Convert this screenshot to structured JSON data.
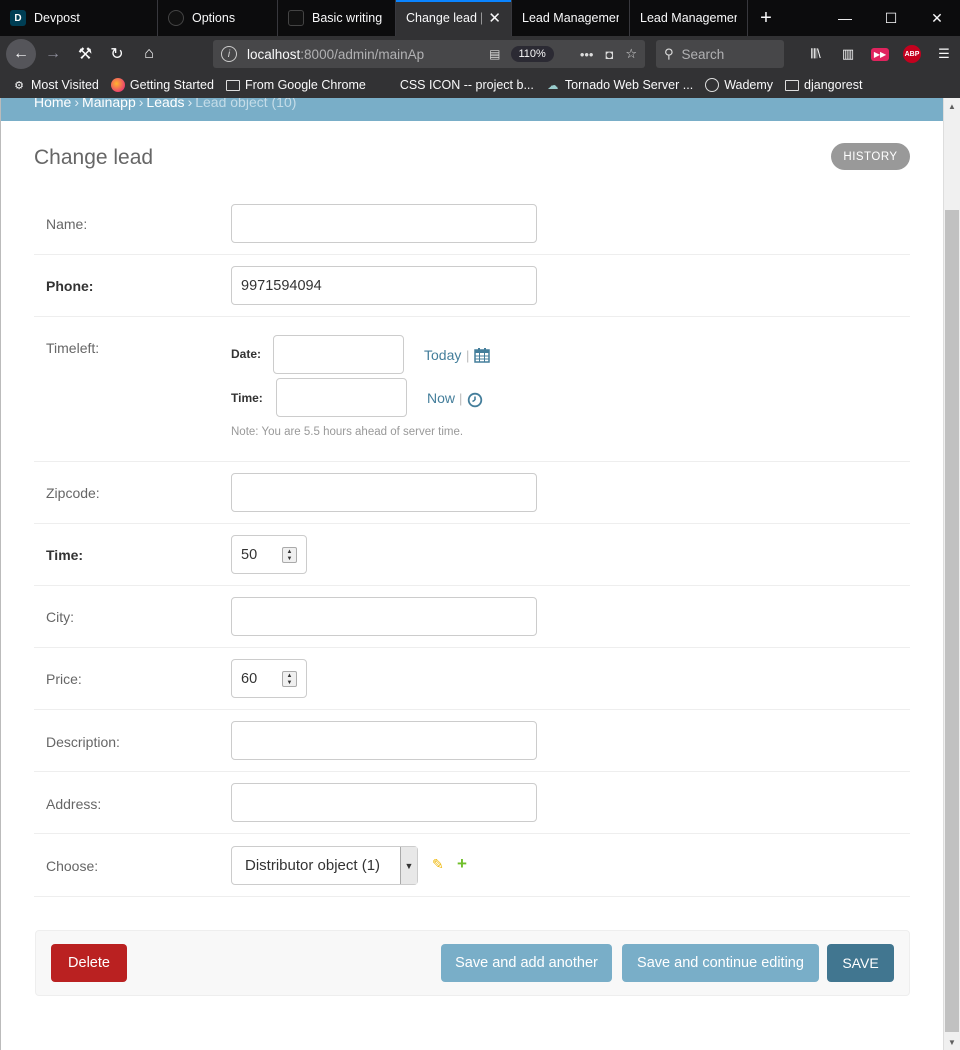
{
  "browser": {
    "tabs": [
      {
        "title": "Devpost",
        "favicon": "D"
      },
      {
        "title": "Options",
        "favicon": ""
      },
      {
        "title": "Basic writing a",
        "favicon": ""
      },
      {
        "title": "Change lead | D",
        "favicon": "",
        "active": true
      },
      {
        "title": "Lead Managemen",
        "favicon": ""
      },
      {
        "title": "Lead Managemen",
        "favicon": ""
      }
    ],
    "url_host": "localhost",
    "url_rest": ":8000/admin/mainAp",
    "zoom": "110%",
    "search_placeholder": "Search",
    "bookmarks": [
      {
        "label": "Most Visited",
        "icon": "gear-icon"
      },
      {
        "label": "Getting Started",
        "icon": "firefox-icon"
      },
      {
        "label": "From Google Chrome",
        "icon": "folder-icon"
      },
      {
        "label": "CSS ICON -- project b...",
        "icon": "blank-icon"
      },
      {
        "label": "Tornado Web Server ...",
        "icon": "tornado-icon"
      },
      {
        "label": "Wademy",
        "icon": "globe-icon"
      },
      {
        "label": "djangorest",
        "icon": "folder-icon"
      }
    ]
  },
  "breadcrumbs": {
    "home": "Home",
    "app": "Mainapp",
    "model": "Leads",
    "current": "Lead object (10)",
    "separator": "›"
  },
  "page": {
    "title": "Change lead",
    "history_label": "HISTORY"
  },
  "form": {
    "name": {
      "label": "Name:",
      "value": ""
    },
    "phone": {
      "label": "Phone:",
      "value": "9971594094"
    },
    "timeleft": {
      "label": "Timeleft:",
      "date_label": "Date:",
      "time_label": "Time:",
      "today_link": "Today",
      "now_link": "Now",
      "pipe": "|",
      "note": "Note: You are 5.5 hours ahead of server time."
    },
    "zipcode": {
      "label": "Zipcode:",
      "value": ""
    },
    "time": {
      "label": "Time:",
      "value": "50"
    },
    "city": {
      "label": "City:",
      "value": ""
    },
    "price": {
      "label": "Price:",
      "value": "60"
    },
    "description": {
      "label": "Description:",
      "value": ""
    },
    "address": {
      "label": "Address:",
      "value": ""
    },
    "choose": {
      "label": "Choose:",
      "selected": "Distributor object (1)"
    }
  },
  "actions": {
    "delete": "Delete",
    "save_add_another": "Save and add another",
    "save_continue": "Save and continue editing",
    "save": "SAVE"
  },
  "colors": {
    "breadcrumb_bg": "#79aec8",
    "link": "#447e9b",
    "delete": "#ba2121",
    "save": "#417690",
    "secondary_button": "#79aec8",
    "edit_icon": "#efb80b",
    "add_icon": "#70bf2b"
  }
}
